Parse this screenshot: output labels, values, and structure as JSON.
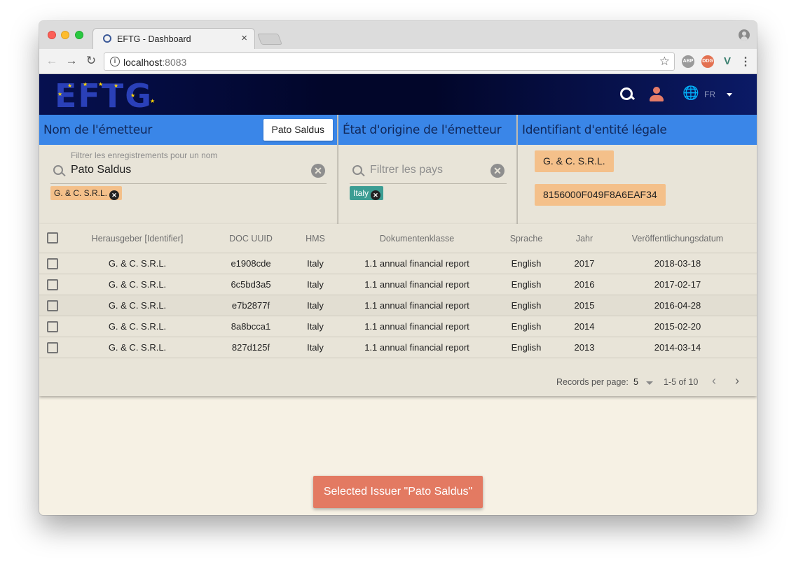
{
  "browser": {
    "tab_title": "EFTG - Dashboard",
    "tab_close": "×",
    "url_host": "localhost",
    "url_port": ":8083",
    "info": "i",
    "star": "☆",
    "back": "←",
    "forward": "→",
    "reload": "↻",
    "menu": "⋮",
    "extensions": [
      "ABP",
      "DDG",
      "V"
    ]
  },
  "header": {
    "logo_text": "EFTG",
    "language": "FR",
    "globe": "🌐"
  },
  "filters": {
    "issuer": {
      "title": "Nom de l'émetteur",
      "selected_button": "Pato Saldus",
      "field_label": "Filtrer les enregistrements pour un nom",
      "field_value": "Pato Saldus",
      "chips": [
        "G. & C. S.R.L."
      ]
    },
    "country": {
      "title": "État d'origine de l'émetteur",
      "placeholder": "Filtrer les pays",
      "chips": [
        "Italy"
      ]
    },
    "lei": {
      "title": "Identifiant d'entité légale",
      "chips": [
        "G. & C. S.R.L.",
        "8156000F049F8A6EAF34"
      ]
    }
  },
  "table": {
    "columns": [
      "Herausgeber [Identifier]",
      "DOC UUID",
      "HMS",
      "Dokumentenklasse",
      "Sprache",
      "Jahr",
      "Veröffentlichungsdatum"
    ],
    "rows": [
      {
        "issuer": "G. & C. S.R.L.",
        "uuid": "e1908cde",
        "hms": "Italy",
        "class": "1.1 annual financial report",
        "lang": "English",
        "year": "2017",
        "date": "2018-03-18"
      },
      {
        "issuer": "G. & C. S.R.L.",
        "uuid": "6c5bd3a5",
        "hms": "Italy",
        "class": "1.1 annual financial report",
        "lang": "English",
        "year": "2016",
        "date": "2017-02-17"
      },
      {
        "issuer": "G. & C. S.R.L.",
        "uuid": "e7b2877f",
        "hms": "Italy",
        "class": "1.1 annual financial report",
        "lang": "English",
        "year": "2015",
        "date": "2016-04-28"
      },
      {
        "issuer": "G. & C. S.R.L.",
        "uuid": "8a8bcca1",
        "hms": "Italy",
        "class": "1.1 annual financial report",
        "lang": "English",
        "year": "2014",
        "date": "2015-02-20"
      },
      {
        "issuer": "G. & C. S.R.L.",
        "uuid": "827d125f",
        "hms": "Italy",
        "class": "1.1 annual financial report",
        "lang": "English",
        "year": "2013",
        "date": "2014-03-14"
      }
    ],
    "footer": {
      "records_per_page_label": "Records per page:",
      "records_per_page": "5",
      "range": "1-5 of 10",
      "prev": "‹",
      "next": "›"
    }
  },
  "snackbar": {
    "message": "Selected Issuer \"Pato Saldus\""
  },
  "colors": {
    "panel_header": "#3a86e8",
    "issuer_chip": "#f4c08a",
    "country_chip": "#3c9d93",
    "snackbar": "#e37a62",
    "app_header": "#02062a"
  }
}
